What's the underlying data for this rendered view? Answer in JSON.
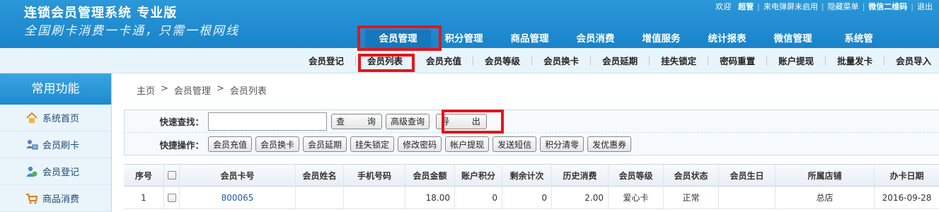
{
  "header": {
    "title": "连锁会员管理系统 专业版",
    "slogan": "全国刷卡消费一卡通，只需一根网线",
    "userbar": {
      "welcome": "欢迎",
      "user": "超管",
      "popup_status": "来电弹屏未启用",
      "hide_menu": "隐藏菜单",
      "wechat_qr": "微信二维码",
      "logout": "退出"
    },
    "main_nav": [
      "会员管理",
      "积分管理",
      "商品管理",
      "会员消费",
      "增值服务",
      "统计报表",
      "微信管理",
      "系统管"
    ]
  },
  "sub_nav": [
    "会员登记",
    "会员列表",
    "会员充值",
    "会员等级",
    "会员换卡",
    "会员延期",
    "挂失锁定",
    "密码重置",
    "账户提现",
    "批量发卡",
    "会员导入"
  ],
  "sidebar": {
    "title": "常用功能",
    "items": [
      {
        "label": "系统首页",
        "icon": "home-icon"
      },
      {
        "label": "会员刷卡",
        "icon": "card-swipe-icon"
      },
      {
        "label": "会员登记",
        "icon": "user-register-icon"
      },
      {
        "label": "商品消费",
        "icon": "cart-icon"
      }
    ]
  },
  "breadcrumb": [
    "主页",
    ">",
    "会员管理",
    ">",
    "会员列表"
  ],
  "search": {
    "label": "快速查找：",
    "value": "",
    "query_button": "查 询",
    "advanced_button": "高级查询",
    "export_button": "导 出"
  },
  "quick_ops": {
    "label": "快捷操作：",
    "buttons": [
      "会员充值",
      "会员换卡",
      "会员延期",
      "挂失锁定",
      "修改密码",
      "帐户提现",
      "发送短信",
      "积分清零",
      "发优惠券"
    ]
  },
  "table": {
    "headers": [
      "序号",
      "",
      "会员卡号",
      "会员姓名",
      "手机号码",
      "会员金额",
      "账户积分",
      "剩余计次",
      "历史消费",
      "会员等级",
      "会员状态",
      "会员生日",
      "所属店铺",
      "办卡日期"
    ],
    "rows": [
      [
        "1",
        "",
        "800065",
        "",
        "",
        "18.00",
        "0",
        "0",
        "2.00",
        "爱心卡",
        "正常",
        "",
        "总店",
        "2016-09-28"
      ]
    ]
  },
  "colors": {
    "header_blue": "#1f8ad0",
    "highlight_red": "#e2161b",
    "link_blue": "#1f5fa8"
  }
}
